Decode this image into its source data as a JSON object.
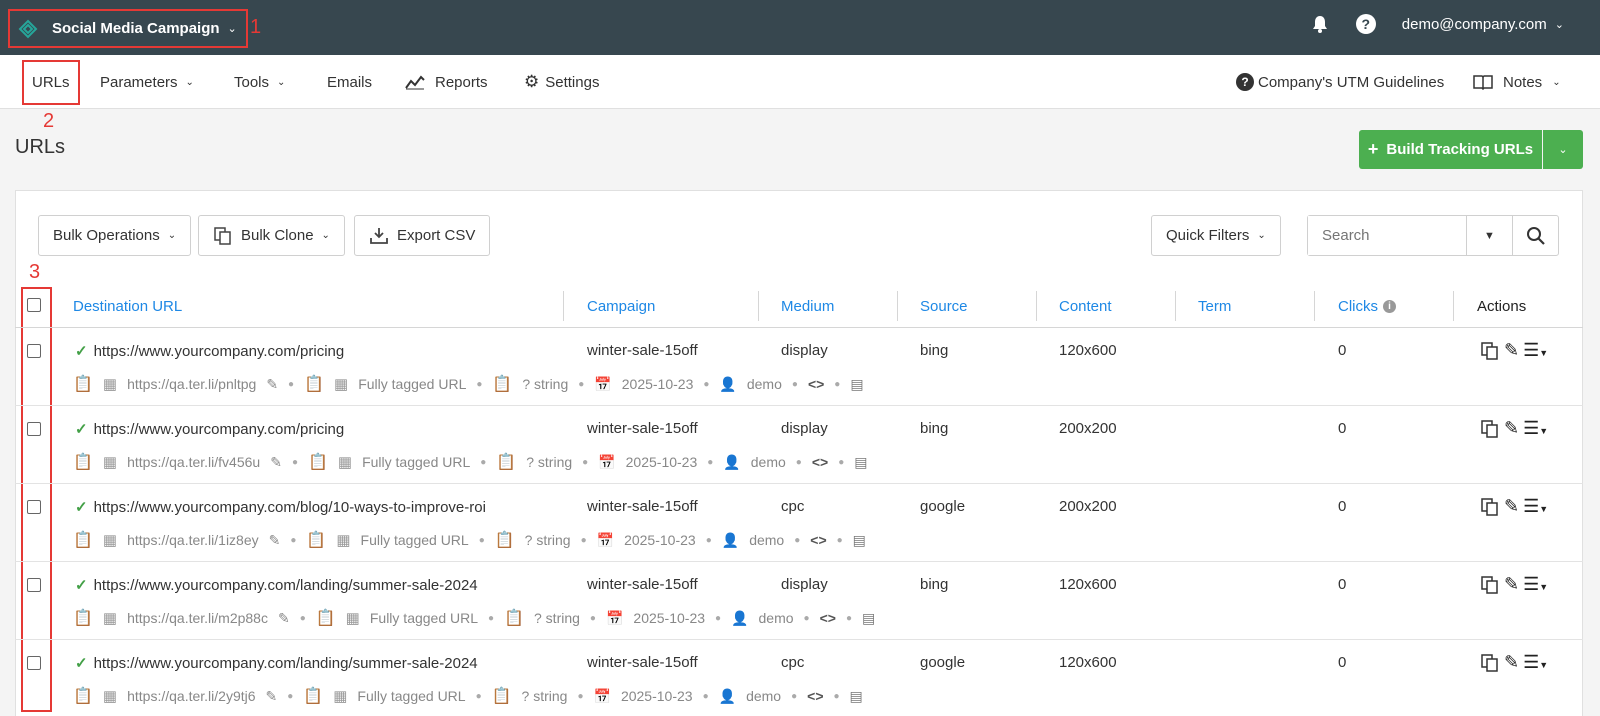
{
  "header": {
    "app_title": "Social Media Campaign",
    "user_email": "demo@company.com",
    "icons": [
      "logo-icon",
      "bell-icon",
      "help-icon",
      "chevron-down-icon"
    ]
  },
  "annotations": {
    "a1": "1",
    "a2": "2",
    "a3": "3"
  },
  "nav": {
    "urls": "URLs",
    "parameters": "Parameters",
    "tools": "Tools",
    "emails": "Emails",
    "reports": "Reports",
    "settings": "Settings",
    "guidelines": "Company's UTM Guidelines",
    "notes": "Notes"
  },
  "page": {
    "title": "URLs",
    "build_button": "Build Tracking URLs"
  },
  "toolbar": {
    "bulk_operations": "Bulk Operations",
    "bulk_clone": "Bulk Clone",
    "export_csv": "Export CSV",
    "quick_filters": "Quick Filters",
    "search_placeholder": "Search"
  },
  "table": {
    "columns": {
      "destination": "Destination URL",
      "campaign": "Campaign",
      "medium": "Medium",
      "source": "Source",
      "content": "Content",
      "term": "Term",
      "clicks": "Clicks",
      "actions": "Actions"
    },
    "rows": [
      {
        "dest": "https://www.yourcompany.com/pricing",
        "campaign": "winter-sale-15off",
        "medium": "display",
        "source": "bing",
        "content": "120x600",
        "term": "",
        "clicks": "0",
        "short_url": "https://qa.ter.li/pnltpg",
        "tagged": "Fully tagged URL",
        "type": "? string",
        "date": "2025-10-23",
        "user": "demo"
      },
      {
        "dest": "https://www.yourcompany.com/pricing",
        "campaign": "winter-sale-15off",
        "medium": "display",
        "source": "bing",
        "content": "200x200",
        "term": "",
        "clicks": "0",
        "short_url": "https://qa.ter.li/fv456u",
        "tagged": "Fully tagged URL",
        "type": "? string",
        "date": "2025-10-23",
        "user": "demo"
      },
      {
        "dest": "https://www.yourcompany.com/blog/10-ways-to-improve-roi",
        "campaign": "winter-sale-15off",
        "medium": "cpc",
        "source": "google",
        "content": "200x200",
        "term": "",
        "clicks": "0",
        "short_url": "https://qa.ter.li/1iz8ey",
        "tagged": "Fully tagged URL",
        "type": "? string",
        "date": "2025-10-23",
        "user": "demo"
      },
      {
        "dest": "https://www.yourcompany.com/landing/summer-sale-2024",
        "campaign": "winter-sale-15off",
        "medium": "display",
        "source": "bing",
        "content": "120x600",
        "term": "",
        "clicks": "0",
        "short_url": "https://qa.ter.li/m2p88c",
        "tagged": "Fully tagged URL",
        "type": "? string",
        "date": "2025-10-23",
        "user": "demo"
      },
      {
        "dest": "https://www.yourcompany.com/landing/summer-sale-2024",
        "campaign": "winter-sale-15off",
        "medium": "cpc",
        "source": "google",
        "content": "120x600",
        "term": "",
        "clicks": "0",
        "short_url": "https://qa.ter.li/2y9tj6",
        "tagged": "Fully tagged URL",
        "type": "? string",
        "date": "2025-10-23",
        "user": "demo"
      }
    ]
  },
  "colors": {
    "topbar": "#37474f",
    "accent_green": "#4caf50",
    "link_blue": "#1e88e5",
    "annotation_red": "#e53935"
  }
}
